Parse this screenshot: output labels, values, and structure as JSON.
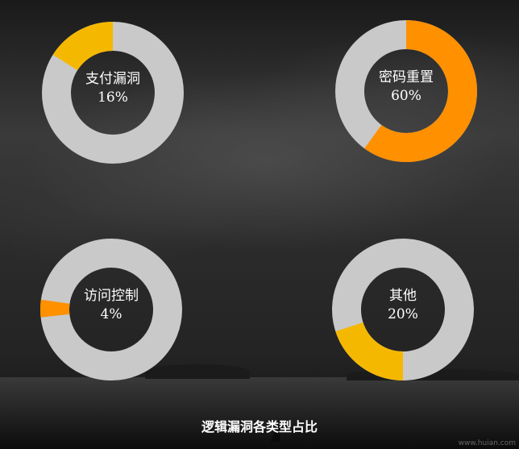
{
  "chart_data": {
    "type": "pie",
    "title": "逻辑漏洞各类型占比",
    "charts": [
      {
        "label": "支付漏洞",
        "value_text": "16%",
        "value": 16,
        "color": "#f5b800"
      },
      {
        "label": "密码重置",
        "value_text": "60%",
        "value": 60,
        "color": "#ff9000"
      },
      {
        "label": "访问控制",
        "value_text": "4%",
        "value": 4,
        "color": "#ff9000"
      },
      {
        "label": "其他",
        "value_text": "20%",
        "value": 20,
        "color": "#f5b800"
      }
    ],
    "track_color": "#c9c9c9"
  },
  "watermark": "www.huian.com"
}
